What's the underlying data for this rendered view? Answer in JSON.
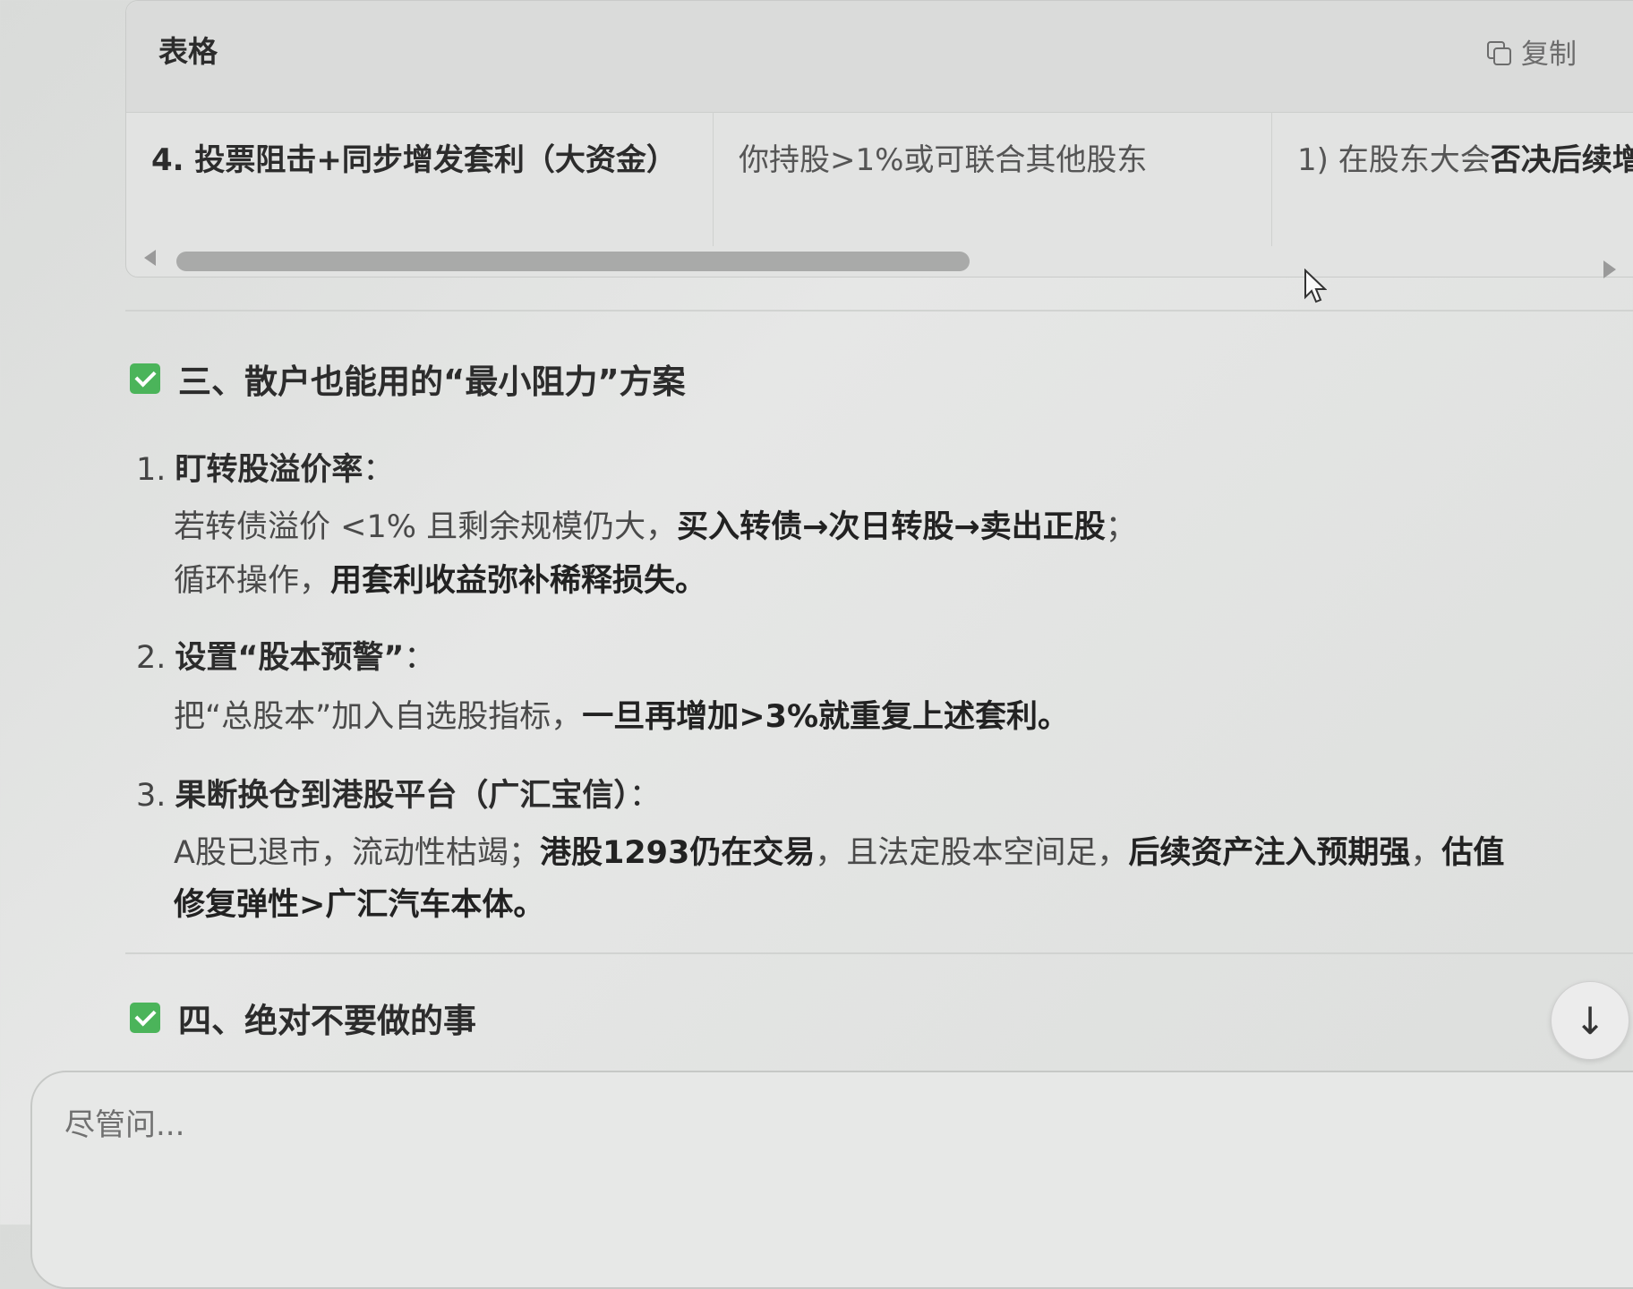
{
  "table": {
    "title": "表格",
    "copy_label": "复制",
    "row": {
      "col1": "4. 投票阻击+同步增发套利（大资金）",
      "col2": "你持股>1%或可联合其他股东",
      "col3_prefix": "1) 在股东大会",
      "col3_bold": "否决后续增"
    }
  },
  "section3": {
    "heading": "三、散户也能用的“最小阻力”方案",
    "items": [
      {
        "num": "1.",
        "title": "盯转股溢价率",
        "suffix": "：",
        "line1_a": "若转债溢价 <1% 且剩余规模仍大，",
        "line1_b": "买入转债→次日转股→卖出正股",
        "line1_c": "；",
        "line2_a": "循环操作，",
        "line2_b": "用套利收益弥补稀释损失。"
      },
      {
        "num": "2.",
        "title": "设置“股本预警”",
        "suffix": "：",
        "line1_a": "把“总股本”加入自选股指标，",
        "line1_b": "一旦再增加>3%就重复上述套利。"
      },
      {
        "num": "3.",
        "title": "果断换仓到港股平台（广汇宝信）",
        "suffix": "：",
        "line1_a": "A股已退市，流动性枯竭；",
        "line1_b": "港股1293仍在交易",
        "line1_c": "，且法定股本空间足，",
        "line1_d": "后续资产注入预期强",
        "line1_e": "，",
        "line1_f": "估值",
        "line2_a": "修复弹性>广汇汽车本体。"
      }
    ]
  },
  "section4": {
    "heading": "四、绝对不要做的事"
  },
  "input": {
    "placeholder": "尽管问..."
  },
  "colors": {
    "check_green": "#4bb45a"
  }
}
